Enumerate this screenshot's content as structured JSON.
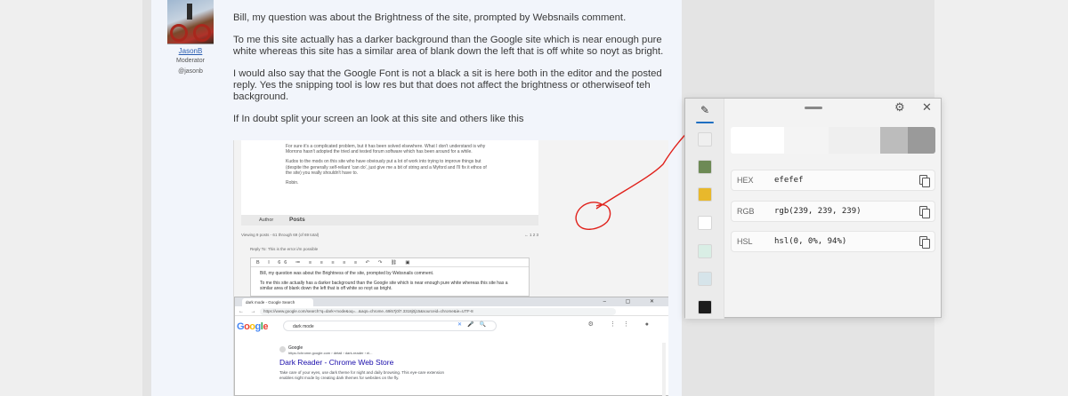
{
  "forum": {
    "user": {
      "name": "JasonB",
      "role": "Moderator",
      "handle": "@jasonb"
    },
    "post_paragraphs": [
      "Bill, my question was about the Brightness of the site, prompted by Websnails comment.",
      "To me this site actually has a darker background than the Google site which is near enough pure white whereas this site has a similar area of blank down the left that is off white so noyt as bright.",
      "I would also say that the Google Font is not a black a sit is here both in the editor and the posted reply. Yes the snipping tool is low res but that does not affect the brightness or otherwiseof teh background.",
      "If In doubt split your screen an look at this site and others like this"
    ]
  },
  "embedded_forum": {
    "quote_paragraphs": [
      "For sure it's a complicated problem, but it has been solved elsewhere. What I don't understand is why Morrons hasn't adopted the tried and tested forum software which has been around for a while.",
      "Kudos to the mods on this site who have obviously put a lot of work into trying to improve things but (despite the generally self-reliant 'can do', just give me a bit of string and a Myford and I'll fix it ethos of the site) you really shouldn't have to.",
      "Robin."
    ],
    "author_label": "Author",
    "posts_label": "Posts",
    "viewing": "Viewing 9 posts - 61 through 69 (of 69 total)",
    "pager": "←  1  2  3",
    "reply_to": "Reply To: This is the error i/m possible",
    "toolbar": "B I 66 ≔ ≡ ≡ ≡ ≡ ≡ ↶ ↷ ⛓ ▣",
    "editor_lines": [
      "Bill, my question was about the Brightness of the site, prompted by Websnails comment.",
      "To me this site actually has a darker background than the Google site which is near enough pure white whereas this site has a similar area of blank down the left that is off white so noyt as bright."
    ]
  },
  "browser": {
    "tab_title": "dark mode - Google Search",
    "url": "https://www.google.com/search?q=dark+mode&oq=...&aqs=chrome..69i57j0l7.3318j0j15&sourceid=chrome&ie=UTF-8",
    "search_query": "dark mode",
    "result": {
      "site": "Google",
      "url": "https://chrome.google.com › detail › dark-reader › ei...",
      "title": "Dark Reader - Chrome Web Store",
      "snippet_1": "Take care of your eyes, use dark theme for night and daily browsing. This eye-care extension",
      "snippet_2": "enables night mode by creating dark themes for websites on the fly."
    }
  },
  "color_picker": {
    "hex_label": "HEX",
    "hex_value": "efefef",
    "rgb_label": "RGB",
    "rgb_value": "rgb(239, 239, 239)",
    "hsl_label": "HSL",
    "hsl_value": "hsl(0, 0%, 94%)",
    "picked_color": "#efefef",
    "shades": [
      "#ffffff",
      "#f4f4f4",
      "#efefef",
      "#bcbcbc",
      "#9a9a9a"
    ],
    "history": [
      "#efefef",
      "#6d8a55",
      "#e8b82c",
      "#ffffff",
      "#d9eee5",
      "#d6e4ea",
      "#1c1c1c"
    ]
  }
}
